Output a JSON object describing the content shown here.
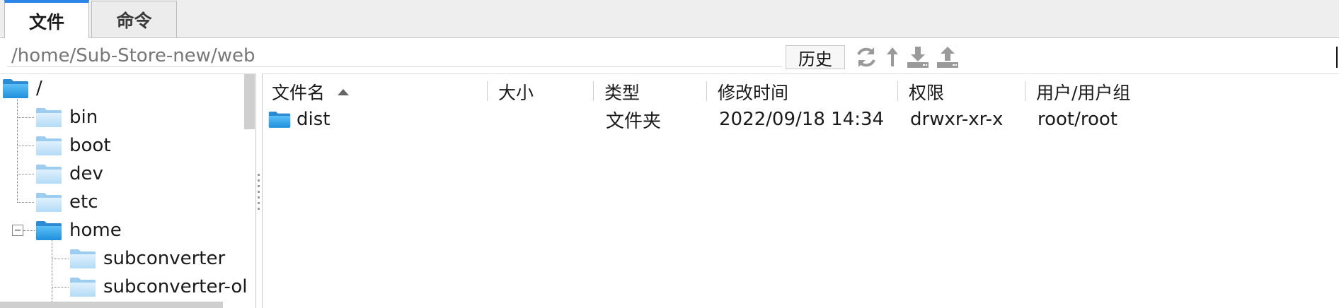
{
  "tabs": [
    {
      "label": "文件",
      "active": true
    },
    {
      "label": "命令",
      "active": false
    }
  ],
  "path": {
    "value": "/home/Sub-Store-new/web",
    "history_label": "历史"
  },
  "toolbar": {
    "icons": [
      "refresh-icon",
      "up-directory-icon",
      "download-icon",
      "upload-icon"
    ]
  },
  "tree": {
    "root_label": "/",
    "items": [
      {
        "label": "bin"
      },
      {
        "label": "boot"
      },
      {
        "label": "dev"
      },
      {
        "label": "etc"
      },
      {
        "label": "home",
        "expanded": true,
        "expander": "−"
      },
      {
        "label": "subconverter"
      },
      {
        "label": "subconverter-ol"
      }
    ]
  },
  "table": {
    "columns": [
      "文件名",
      "大小",
      "类型",
      "修改时间",
      "权限",
      "用户/用户组"
    ],
    "rows": [
      {
        "name": "dist",
        "size": "",
        "type": "文件夹",
        "modified": "2022/09/18 14:34",
        "permissions": "drwxr-xr-x",
        "owner": "root/root"
      }
    ]
  },
  "colors": {
    "accent": "#2b86e8",
    "folder_blue": "#3aa0e6",
    "folder_light": "#bfe3fb"
  }
}
